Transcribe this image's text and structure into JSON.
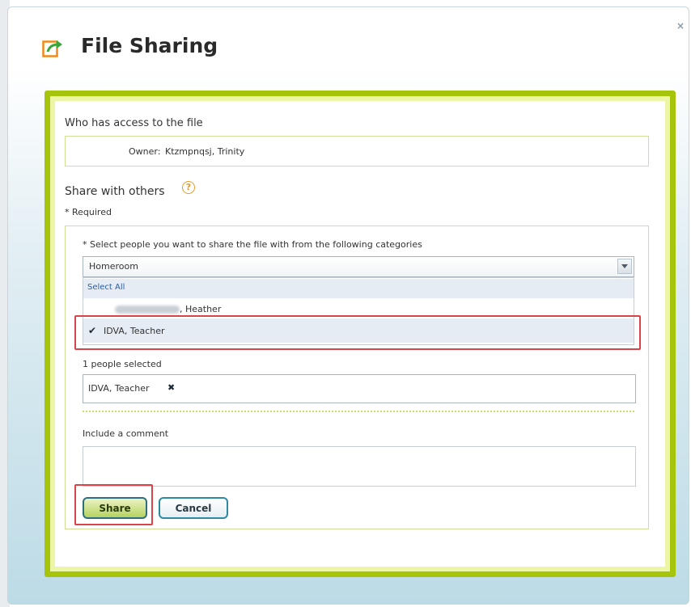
{
  "dialog": {
    "title": "File Sharing",
    "close_symbol": "×",
    "icons": {
      "title": "share-file-icon",
      "close": "close-icon",
      "help": "help-icon",
      "check": "checkmark-icon",
      "remove": "remove-x-icon",
      "dropdown": "chevron-down-icon"
    },
    "colors": {
      "frame_green": "#a6c40c",
      "highlight_red": "#d9434a",
      "help_orange": "#e79a2a"
    }
  },
  "access": {
    "heading": "Who has access to the file",
    "owner_label": "Owner:",
    "owner_name": "Ktzmpnqsj, Trinity"
  },
  "share": {
    "heading": "Share with others",
    "help_symbol": "?",
    "required_note": "* Required",
    "select_prompt": "* Select people you want to share the file with from the following categories",
    "category_value": "Homeroom",
    "select_all": "Select All",
    "options": [
      {
        "label": ", Heather",
        "checked": false
      },
      {
        "label": "IDVA, Teacher",
        "checked": true
      }
    ],
    "check_symbol": "✔",
    "selected_count": "1 people selected",
    "selected_token": "IDVA, Teacher",
    "remove_symbol": "✖",
    "comment_label": "Include a comment",
    "comment_value": ""
  },
  "buttons": {
    "share": "Share",
    "cancel": "Cancel"
  }
}
